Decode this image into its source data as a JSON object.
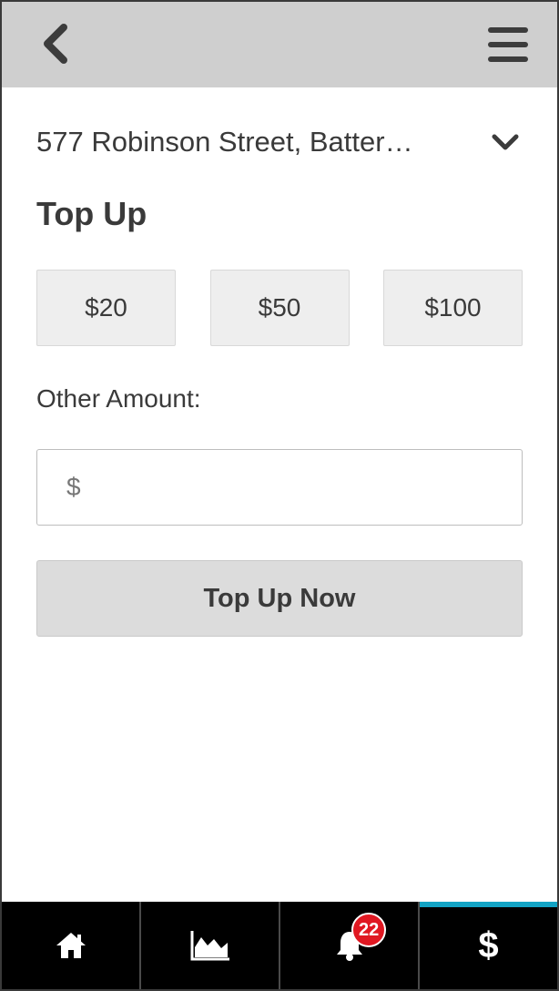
{
  "header": {
    "back_icon": "chevron-left-icon",
    "menu_icon": "hamburger-menu-icon"
  },
  "location": {
    "label": "577 Robinson Street, Batter…",
    "dropdown_icon": "chevron-down-icon"
  },
  "topup": {
    "title": "Top Up",
    "amounts": [
      "$20",
      "$50",
      "$100"
    ],
    "other_label": "Other Amount:",
    "other_placeholder": "$",
    "other_value": "",
    "submit_label": "Top Up Now"
  },
  "tabbar": {
    "tabs": [
      {
        "icon": "home-icon",
        "active": false
      },
      {
        "icon": "area-chart-icon",
        "active": false
      },
      {
        "icon": "bell-icon",
        "active": false,
        "badge": "22"
      },
      {
        "icon": "dollar-icon",
        "active": true,
        "glyph": "$"
      }
    ],
    "active_color": "#12a3c4",
    "badge_color": "#e01822"
  }
}
